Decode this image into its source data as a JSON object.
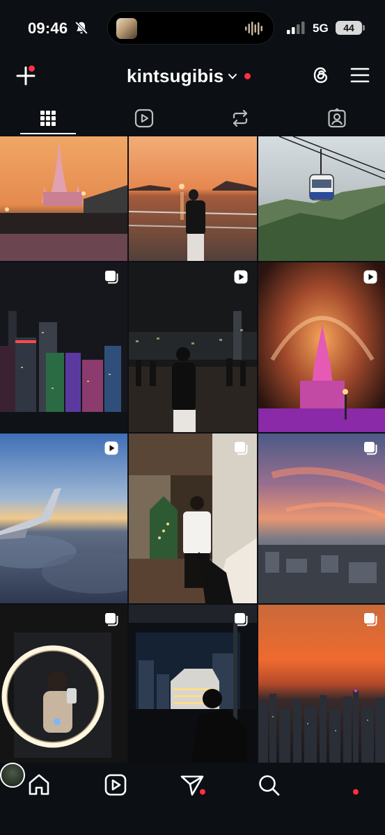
{
  "status_bar": {
    "time": "09:46",
    "network": "5G",
    "battery": "44"
  },
  "header": {
    "username": "kintsugibis",
    "notification_dot_color": "#ff3040"
  },
  "tabs": [
    {
      "name": "grid",
      "icon": "grid-icon",
      "active": true
    },
    {
      "name": "reels",
      "icon": "reels-icon",
      "active": false
    },
    {
      "name": "reposts",
      "icon": "repost-icon",
      "active": false
    },
    {
      "name": "tagged",
      "icon": "tagged-person-icon",
      "active": false
    }
  ],
  "posts": [
    {
      "subject": "castle sunset",
      "badge": "none"
    },
    {
      "subject": "man at harbor sunset",
      "badge": "none"
    },
    {
      "subject": "cable car over hills",
      "badge": "none"
    },
    {
      "subject": "city skyline night",
      "badge": "carousel"
    },
    {
      "subject": "man at waterfront night",
      "badge": "reel"
    },
    {
      "subject": "castle fireworks",
      "badge": "reel"
    },
    {
      "subject": "airplane wing above clouds",
      "badge": "reel"
    },
    {
      "subject": "man in hotel lobby",
      "badge": "carousel"
    },
    {
      "subject": "city sunset sky",
      "badge": "carousel"
    },
    {
      "subject": "mirror selfie ring light",
      "badge": "carousel"
    },
    {
      "subject": "window night city view",
      "badge": "carousel"
    },
    {
      "subject": "orange sky skyline",
      "badge": "carousel"
    }
  ],
  "bottom_nav": [
    "home-icon",
    "reels-icon",
    "messages-icon",
    "search-icon",
    "profile-avatar"
  ]
}
